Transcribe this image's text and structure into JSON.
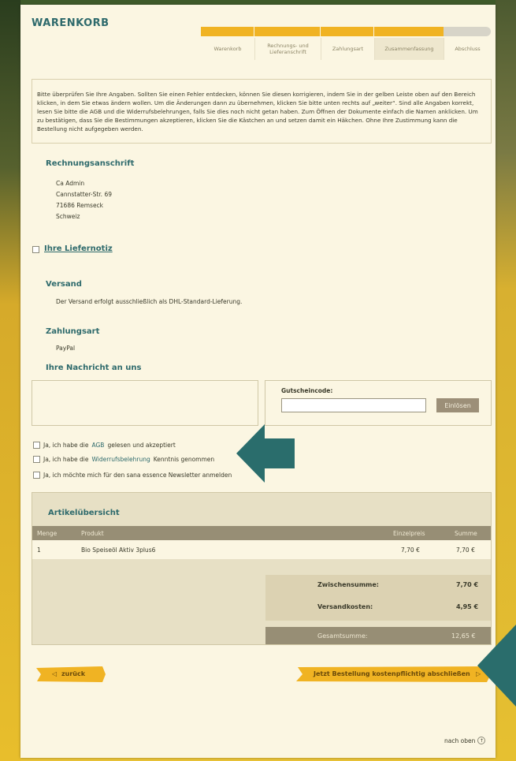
{
  "header": {
    "title": "WARENKORB"
  },
  "progress": {
    "steps": [
      {
        "label": "Warenkorb",
        "done": true
      },
      {
        "label": "Rechnungs- und Lieferanschrift",
        "done": true
      },
      {
        "label": "Zahlungsart",
        "done": true
      },
      {
        "label": "Zusammenfassung",
        "done": true,
        "active": true
      },
      {
        "label": "Abschluss",
        "done": false
      }
    ],
    "done_color": "#f0b323",
    "todo_color": "#d7d4c8"
  },
  "info_text": "Bitte überprüfen Sie Ihre Angaben. Sollten Sie einen Fehler entdecken, können Sie diesen korrigieren, indem Sie in der gelben Leiste oben auf den Bereich klicken, in dem Sie etwas ändern wollen. Um die Änderungen dann zu übernehmen, klicken Sie bitte unten rechts auf „weiter“. Sind alle Angaben korrekt, lesen Sie bitte die AGB und die Widerrufsbelehrungen, falls Sie dies noch nicht getan haben. Zum Öffnen der Dokumente einfach die Namen anklicken. Um zu bestätigen, dass Sie die Bestimmungen akzeptieren, klicken Sie die Kästchen an und setzen damit ein Häkchen. Ohne Ihre Zustimmung kann die Bestellung nicht aufgegeben werden.",
  "billing": {
    "title": "Rechnungsanschrift",
    "lines": [
      "Ca Admin",
      "Cannstatter-Str. 69",
      "71686 Remseck",
      "Schweiz"
    ]
  },
  "delivery_note": {
    "label": "Ihre Liefernotiz"
  },
  "shipping": {
    "title": "Versand",
    "text": "Der Versand erfolgt ausschließlich als DHL-Standard-Lieferung."
  },
  "payment": {
    "title": "Zahlungsart",
    "method": "PayPal"
  },
  "message": {
    "title": "Ihre Nachricht an uns",
    "value": ""
  },
  "coupon": {
    "label": "Gutscheincode:",
    "value": "",
    "button": "Einlösen"
  },
  "consents": [
    {
      "before": "Ja, ich habe die",
      "link": "AGB",
      "after": "gelesen und akzeptiert"
    },
    {
      "before": "Ja, ich habe die",
      "link": "Widerrufsbelehrung",
      "after": "Kenntnis genommen"
    },
    {
      "before": "Ja, ich möchte mich für den sana essence Newsletter anmelden",
      "link": "",
      "after": ""
    }
  ],
  "articles": {
    "title": "Artikelübersicht",
    "columns": {
      "qty": "Menge",
      "product": "Produkt",
      "unit": "Einzelpreis",
      "sum": "Summe"
    },
    "rows": [
      {
        "qty": "1",
        "product": "Bio Speiseöl Aktiv 3plus6",
        "unit": "7,70 €",
        "sum": "7,70 €"
      }
    ],
    "subtotal_label": "Zwischensumme:",
    "subtotal": "7,70 €",
    "shipping_label": "Versandkosten:",
    "shipping": "4,95 €",
    "total_label": "Gesamtsumme:",
    "total": "12,65 €"
  },
  "nav": {
    "back": "zurück",
    "order": "Jetzt Bestellung kostenpflichtig abschließen",
    "to_top": "nach oben"
  },
  "colors": {
    "accent": "#2e6a6c",
    "yellow": "#f0b323",
    "arrow": "#2a6d6c"
  }
}
